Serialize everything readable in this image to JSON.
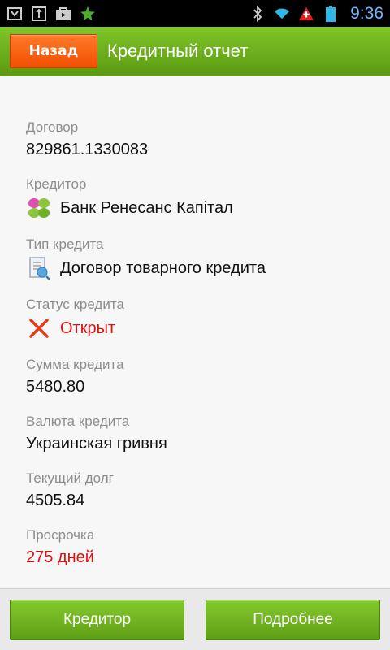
{
  "status_bar": {
    "time": "9:36",
    "icons": [
      "notification-icon",
      "usb-icon",
      "store-icon",
      "star-icon",
      "bluetooth-icon",
      "wifi-icon",
      "alert-icon",
      "battery-icon"
    ]
  },
  "header": {
    "back_label": "Назад",
    "title": "Кредитный отчет"
  },
  "fields": {
    "contract": {
      "label": "Договор",
      "value": "829861.1330083"
    },
    "creditor": {
      "label": "Кредитор",
      "value": "Банк Ренесанс Капітал",
      "icon": "bank-logo-icon"
    },
    "credit_type": {
      "label": "Тип кредита",
      "value": "Договор товарного кредита",
      "icon": "document-icon"
    },
    "status": {
      "label": "Статус кредита",
      "value": "Открыт",
      "icon": "cross-icon"
    },
    "amount": {
      "label": "Сумма кредита",
      "value": "5480.80"
    },
    "currency": {
      "label": "Валюта кредита",
      "value": "Украинская гривня"
    },
    "debt": {
      "label": "Текущий долг",
      "value": "4505.84"
    },
    "overdue": {
      "label": "Просрочка",
      "value": "275 дней"
    }
  },
  "bottom": {
    "creditor_btn": "Кредитор",
    "details_btn": "Подробнее"
  },
  "colors": {
    "header_green": "#6fb31f",
    "back_orange": "#f46010",
    "alert_red": "#e01010",
    "time_blue": "#6fb7ff"
  }
}
